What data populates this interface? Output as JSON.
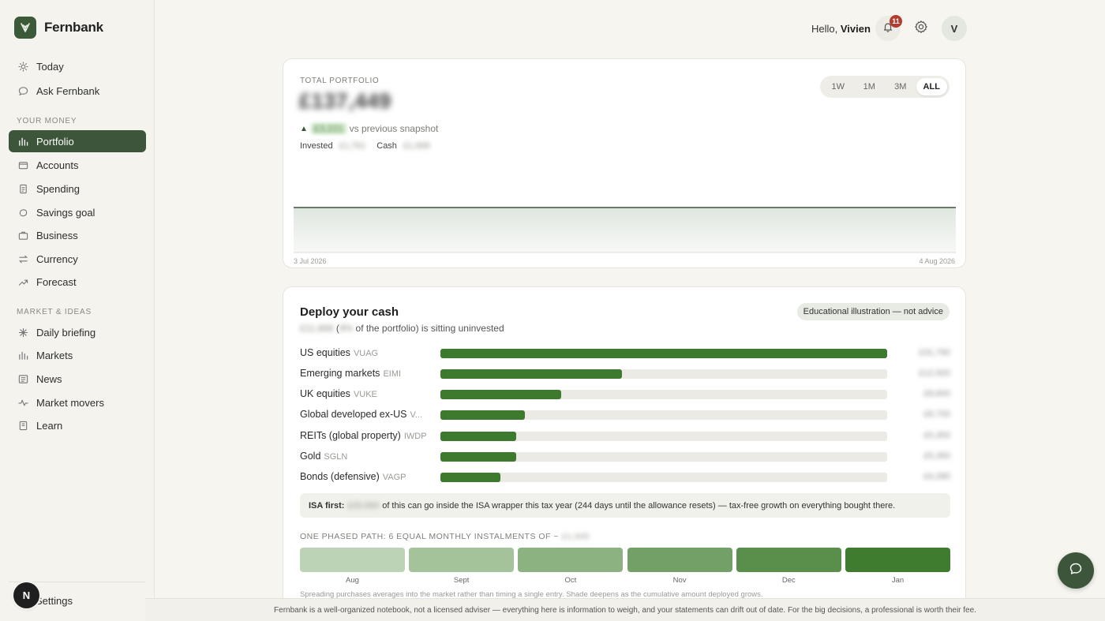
{
  "brand": {
    "name": "Fernbank"
  },
  "nav": {
    "top": [
      {
        "label": "Today",
        "icon": "sun-icon"
      },
      {
        "label": "Ask Fernbank",
        "icon": "chat-bubble-icon"
      }
    ],
    "your_money_label": "YOUR MONEY",
    "your_money": [
      {
        "label": "Portfolio",
        "icon": "bar-chart-icon",
        "active": true
      },
      {
        "label": "Accounts",
        "icon": "wallet-icon"
      },
      {
        "label": "Spending",
        "icon": "receipt-icon"
      },
      {
        "label": "Savings goal",
        "icon": "piggy-bank-icon"
      },
      {
        "label": "Business",
        "icon": "briefcase-icon"
      },
      {
        "label": "Currency",
        "icon": "exchange-icon"
      },
      {
        "label": "Forecast",
        "icon": "trend-up-icon"
      }
    ],
    "market_label": "MARKET & IDEAS",
    "market": [
      {
        "label": "Daily briefing",
        "icon": "sparkle-icon"
      },
      {
        "label": "Markets",
        "icon": "bar-chart-icon"
      },
      {
        "label": "News",
        "icon": "newspaper-icon"
      },
      {
        "label": "Market movers",
        "icon": "pulse-icon"
      },
      {
        "label": "Learn",
        "icon": "book-icon"
      }
    ],
    "settings_label": "Settings",
    "badge_letter": "N"
  },
  "header": {
    "greeting": "Hello,",
    "user_name": "Vivien",
    "notification_count": "11",
    "avatar_letter": "V"
  },
  "portfolio": {
    "label": "TOTAL PORTFOLIO",
    "value": "£137,449",
    "change_value": "£3,221",
    "change_suffix": "vs previous snapshot",
    "invested_label": "Invested",
    "invested_value": "£1,761",
    "cash_label": "Cash",
    "cash_value": "£1,668",
    "ranges": [
      "1W",
      "1M",
      "3M",
      "ALL"
    ],
    "selected_range": "ALL",
    "start_date": "3 Jul 2026",
    "end_date": "4 Aug 2026",
    "line_color": "#3d553a"
  },
  "deploy": {
    "title": "Deploy your cash",
    "badge": "Educational illustration — not advice",
    "sub_amount": "£11,668",
    "sub_pct": "9%",
    "sub_text": "of the portfolio) is sitting uninvested",
    "allocations": [
      {
        "label": "US equities",
        "ticker": "VUAG",
        "fraction": 1.0,
        "amount": "£31,790"
      },
      {
        "label": "Emerging markets",
        "ticker": "EIMI",
        "fraction": 0.406,
        "amount": "£12,920"
      },
      {
        "label": "UK equities",
        "ticker": "VUKE",
        "fraction": 0.271,
        "amount": "£8,600"
      },
      {
        "label": "Global developed ex-US",
        "ticker": "V...",
        "fraction": 0.189,
        "amount": "£6,700"
      },
      {
        "label": "REITs (global property)",
        "ticker": "IWDP",
        "fraction": 0.169,
        "amount": "£5,350"
      },
      {
        "label": "Gold",
        "ticker": "SGLN",
        "fraction": 0.169,
        "amount": "£5,350"
      },
      {
        "label": "Bonds (defensive)",
        "ticker": "VAGP",
        "fraction": 0.135,
        "amount": "£4,280"
      }
    ],
    "isa_label": "ISA first:",
    "isa_amount": "£20,000",
    "isa_text": "of this can go inside the ISA wrapper this tax year (244 days until the allowance resets) — tax-free growth on everything bought there.",
    "phase_label": "ONE PHASED PATH: 6 EQUAL MONTHLY INSTALMENTS OF ~",
    "phase_amount": "£1,945",
    "months": [
      {
        "label": "Aug",
        "color": "#bcd4b5"
      },
      {
        "label": "Sept",
        "color": "#a4c39b"
      },
      {
        "label": "Oct",
        "color": "#8cb281"
      },
      {
        "label": "Nov",
        "color": "#73a066"
      },
      {
        "label": "Dec",
        "color": "#5a8e4b"
      },
      {
        "label": "Jan",
        "color": "#3f7c2f"
      }
    ],
    "phase_note": "Spreading purchases averages into the market rather than timing a single entry. Shade deepens as the cumulative amount deployed grows."
  },
  "footer": {
    "text": "Fernbank is a well-organized notebook, not a licensed adviser — everything here is information to weigh, and your statements can drift out of date. For the big decisions, a professional is worth their fee."
  },
  "colors": {
    "accent": "#3d553a",
    "bar": "#3e7a2e",
    "notification": "#b13d2f"
  }
}
